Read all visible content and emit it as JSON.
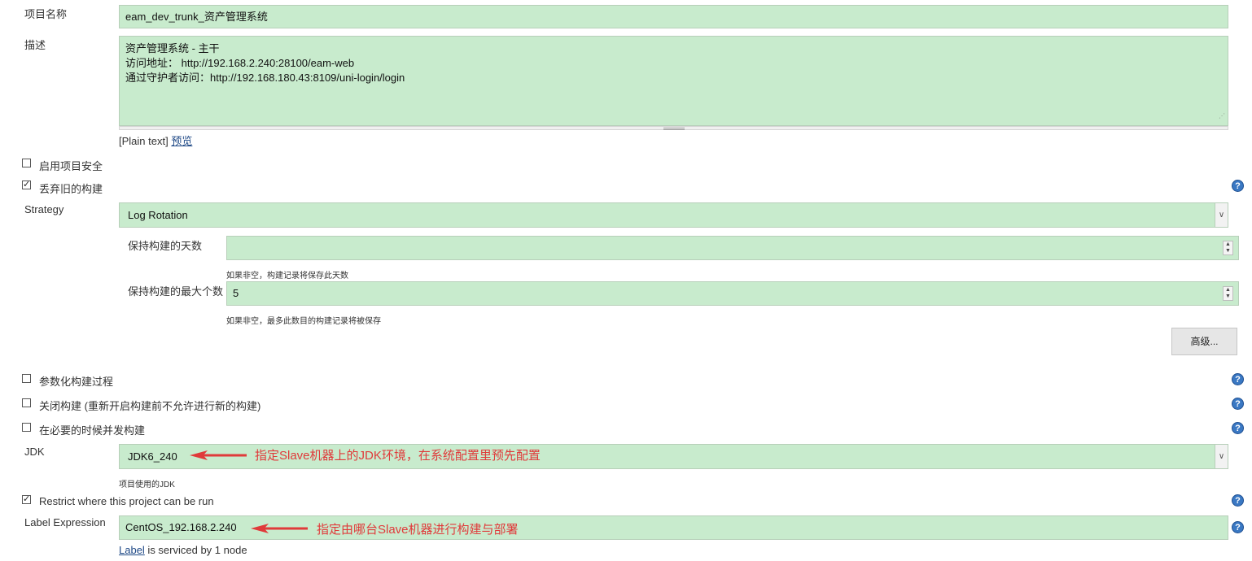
{
  "project": {
    "name_label": "项目名称",
    "name_value": "eam_dev_trunk_资产管理系统",
    "desc_label": "描述",
    "desc_lines": [
      "资产管理系统 - 主干",
      "访问地址： http://192.168.2.240:28100/eam-web",
      "通过守护者访问：http://192.168.180.43:8109/uni-login/login"
    ],
    "plain_text": "[Plain text]",
    "preview_link": "预览"
  },
  "options": {
    "enable_security": {
      "label": "启用项目安全",
      "checked": false
    },
    "discard_old": {
      "label": "丢弃旧的构建",
      "checked": true
    },
    "parameterized": {
      "label": "参数化构建过程",
      "checked": false
    },
    "disable_build": {
      "label": "关闭构建 (重新开启构建前不允许进行新的构建)",
      "checked": false
    },
    "concurrent": {
      "label": "在必要的时候并发构建",
      "checked": false
    },
    "restrict": {
      "label": "Restrict where this project can be run",
      "checked": true
    }
  },
  "strategy": {
    "label": "Strategy",
    "value": "Log Rotation",
    "days_label": "保持构建的天数",
    "days_value": "",
    "days_hint": "如果非空，构建记录将保存此天数",
    "max_label": "保持构建的最大个数",
    "max_value": "5",
    "max_hint": "如果非空，最多此数目的构建记录将被保存",
    "advanced_button": "高级..."
  },
  "jdk": {
    "label": "JDK",
    "value": "JDK6_240",
    "hint": "项目使用的JDK",
    "annotation": "指定Slave机器上的JDK环境，在系统配置里预先配置"
  },
  "label_expr": {
    "label": "Label Expression",
    "value": "CentOS_192.168.2.240",
    "annotation": "指定由哪台Slave机器进行构建与部署",
    "link": "Label",
    "serviced_text": " is serviced by 1 node"
  },
  "colors": {
    "field_bg": "#c8ebcd",
    "annotation": "#e03a3a",
    "help_icon": "#3a78c3"
  }
}
